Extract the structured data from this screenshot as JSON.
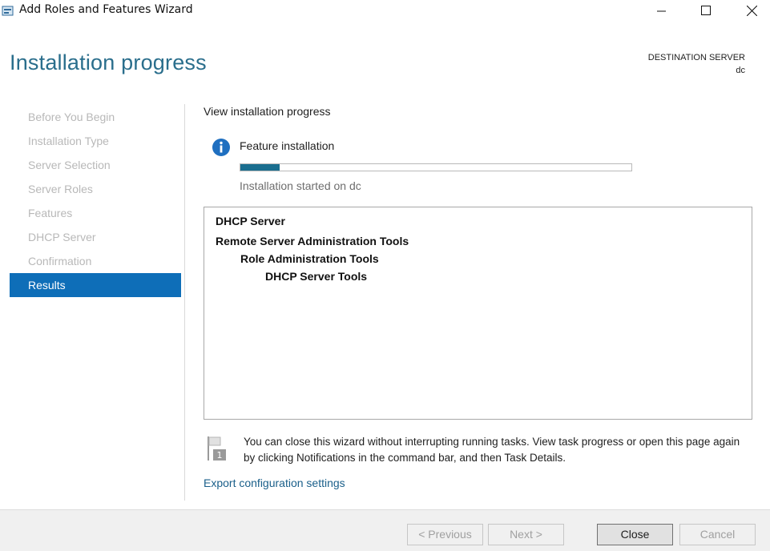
{
  "window": {
    "title": "Add Roles and Features Wizard",
    "icon": "server-manager-icon",
    "controls": [
      "minimize-icon",
      "maximize-icon",
      "close-icon"
    ]
  },
  "header": {
    "page_title": "Installation progress",
    "destination_label": "DESTINATION SERVER",
    "destination_value": "dc"
  },
  "nav": {
    "items": [
      {
        "label": "Before You Begin",
        "state": "disabled"
      },
      {
        "label": "Installation Type",
        "state": "disabled"
      },
      {
        "label": "Server Selection",
        "state": "disabled"
      },
      {
        "label": "Server Roles",
        "state": "disabled"
      },
      {
        "label": "Features",
        "state": "disabled"
      },
      {
        "label": "DHCP Server",
        "state": "disabled"
      },
      {
        "label": "Confirmation",
        "state": "disabled"
      },
      {
        "label": "Results",
        "state": "active"
      }
    ]
  },
  "main": {
    "heading": "View installation progress",
    "status_icon": "info-icon",
    "status_title": "Feature installation",
    "progress_fraction": 0.1,
    "status_message": "Installation started on dc",
    "results": [
      {
        "text": "DHCP Server",
        "level": 0
      },
      {
        "text": "Remote Server Administration Tools",
        "level": 0
      },
      {
        "text": "Role Administration Tools",
        "level": 1
      },
      {
        "text": "DHCP Server Tools",
        "level": 2
      }
    ],
    "notice": "You can close this wizard without interrupting running tasks. View task progress or open this page again by clicking Notifications in the command bar, and then Task Details.",
    "notice_icon": "notification-flag-icon",
    "export_link": "Export configuration settings"
  },
  "footer": {
    "previous_label": "< Previous",
    "next_label": "Next >",
    "close_label": "Close",
    "cancel_label": "Cancel"
  },
  "colors": {
    "accent_nav": "#0e6eb8",
    "heading": "#2a6e8c",
    "progress": "#1a6e8f",
    "link": "#1a5f8a"
  }
}
